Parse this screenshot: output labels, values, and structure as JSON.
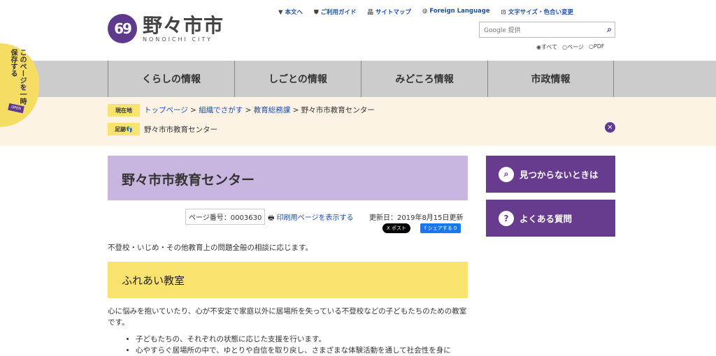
{
  "header": {
    "logo_jp": "野々市市",
    "logo_en": "NONOICHI CITY",
    "util": [
      {
        "icon": "down-arrow-icon",
        "label": "本文へ"
      },
      {
        "icon": "shield-icon",
        "label": "ご利用ガイド"
      },
      {
        "icon": "sitemap-icon",
        "label": "サイトマップ"
      },
      {
        "icon": "globe-icon",
        "label": "Foreign Language"
      },
      {
        "icon": "settings-icon",
        "label": "文字サイズ・色合い変更"
      }
    ],
    "search_placeholder": "Google 提供",
    "radios": [
      "すべて",
      "ページ",
      "PDF"
    ]
  },
  "save_tab": {
    "label": "このページを一時保存する",
    "badge": "OPEN"
  },
  "nav": [
    "くらしの情報",
    "しごとの情報",
    "みどころ情報",
    "市政情報"
  ],
  "breadcrumb": {
    "current_tag": "現在地",
    "links": [
      "トップページ",
      "組織でさがす",
      "教育総務課"
    ],
    "current": "野々市市教育センター",
    "sep": ">",
    "history_tag": "足跡",
    "history": "野々市市教育センター"
  },
  "main": {
    "title": "野々市市教育センター",
    "page_no": "ページ番号：0003630",
    "print": "印刷用ページを表示する",
    "updated": "更新日：2019年8月15日更新",
    "x_post": "X ポスト",
    "fb_share": "f シェアする 0",
    "lead": "不登校・いじめ・その他教育上の問題全般の相談に応じます。",
    "h2": "ふれあい教室",
    "body": "心に悩みを抱いていたり、心が不安定で家庭以外に居場所を失っている不登校などの子どもたちのための教室です。",
    "list": [
      "子どもたちの、それぞれの状態に応じた支援を行います。",
      "心やすらぐ居場所の中で、ゆとりや自信を取り戻し、さまざまな体験活動を通して社会性を身に"
    ]
  },
  "sidebar": [
    {
      "label": "見つからないときは",
      "icon": "search-face-icon"
    },
    {
      "label": "よくある質問",
      "icon": "faq-icon"
    }
  ]
}
